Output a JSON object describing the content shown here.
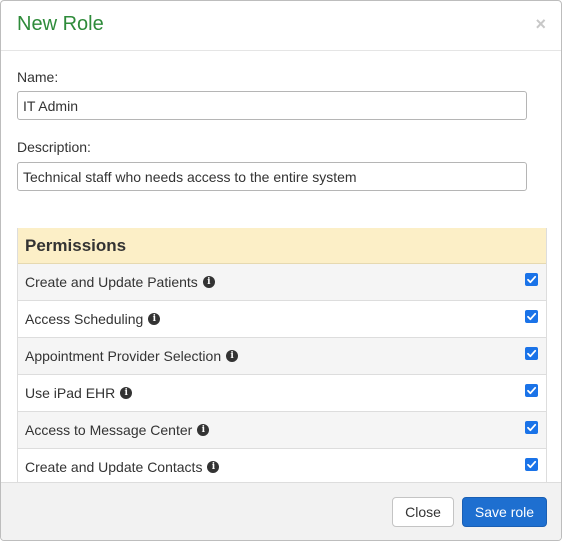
{
  "dialog": {
    "title": "New Role",
    "close_glyph": "×"
  },
  "form": {
    "name_label": "Name:",
    "name_value": "IT Admin",
    "description_label": "Description:",
    "description_value": "Technical staff who needs access to the entire system"
  },
  "permissions": {
    "title": "Permissions",
    "info_icon": "i",
    "items": [
      {
        "label": "Create and Update Patients",
        "checked": true
      },
      {
        "label": "Access Scheduling",
        "checked": true
      },
      {
        "label": "Appointment Provider Selection",
        "checked": true
      },
      {
        "label": "Use iPad EHR",
        "checked": true
      },
      {
        "label": "Access to Message Center",
        "checked": true
      },
      {
        "label": "Create and Update Contacts",
        "checked": true
      },
      {
        "label": "",
        "checked": true
      }
    ]
  },
  "footer": {
    "close_label": "Close",
    "save_label": "Save role"
  },
  "colors": {
    "title_green": "#2e8b3a",
    "permissions_header_bg": "#fcefc7",
    "primary_button": "#1e6fd0",
    "checkbox_blue": "#1a73e8"
  }
}
